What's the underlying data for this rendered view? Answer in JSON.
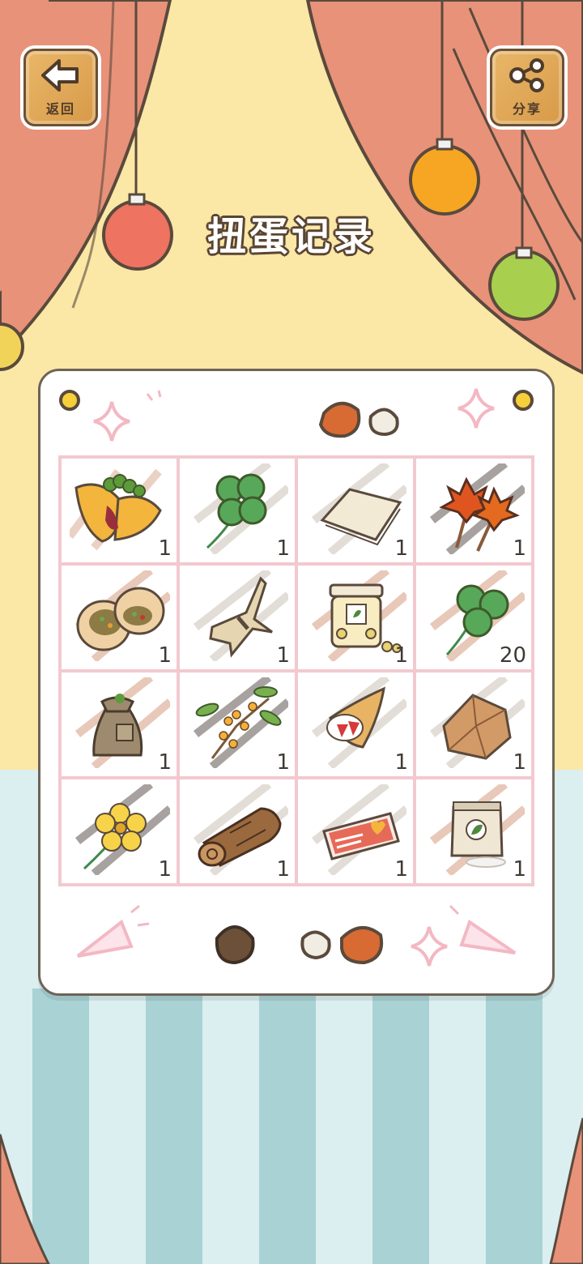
{
  "header": {
    "back_label": "返回",
    "share_label": "分享",
    "title": "扭蛋记录"
  },
  "colors": {
    "curtain": "#e8927a",
    "backdrop": "#fbe7a6",
    "floor_light": "#dbeef0",
    "stripe": "#a9d2d5",
    "panel_border": "#6d6356",
    "grid_line": "#f2c9cf"
  },
  "items": [
    {
      "name": "omelette-icon",
      "count": "1",
      "hatch": "#d9a58a"
    },
    {
      "name": "four-leaf-clover-icon",
      "count": "1",
      "hatch": "#e2ddd6"
    },
    {
      "name": "paper-sheets-icon",
      "count": "1",
      "hatch": "#e2ddd6"
    },
    {
      "name": "maple-leaves-icon",
      "count": "1",
      "hatch": "#6e6660"
    },
    {
      "name": "stuffed-bun-icon",
      "count": "1",
      "hatch": "#d9a58a"
    },
    {
      "name": "bark-bundle-icon",
      "count": "1",
      "hatch": "#e2ddd6"
    },
    {
      "name": "bean-jar-icon",
      "count": "1",
      "hatch": "#d9a58a"
    },
    {
      "name": "three-leaf-clover-icon",
      "count": "20",
      "hatch": "#d9a58a"
    },
    {
      "name": "seed-sack-icon",
      "count": "1",
      "hatch": "#d9a58a"
    },
    {
      "name": "osmanthus-sprig-icon",
      "count": "1",
      "hatch": "#6e6660"
    },
    {
      "name": "strawberry-crepe-icon",
      "count": "1",
      "hatch": "#e2ddd6"
    },
    {
      "name": "stone-icon",
      "count": "1",
      "hatch": "#e2ddd6"
    },
    {
      "name": "yellow-flower-icon",
      "count": "1",
      "hatch": "#6e6660"
    },
    {
      "name": "log-icon",
      "count": "1",
      "hatch": "#e2ddd6"
    },
    {
      "name": "red-ticket-icon",
      "count": "1",
      "hatch": "#e2ddd6"
    },
    {
      "name": "tea-bag-icon",
      "count": "1",
      "hatch": "#d9a58a"
    }
  ]
}
